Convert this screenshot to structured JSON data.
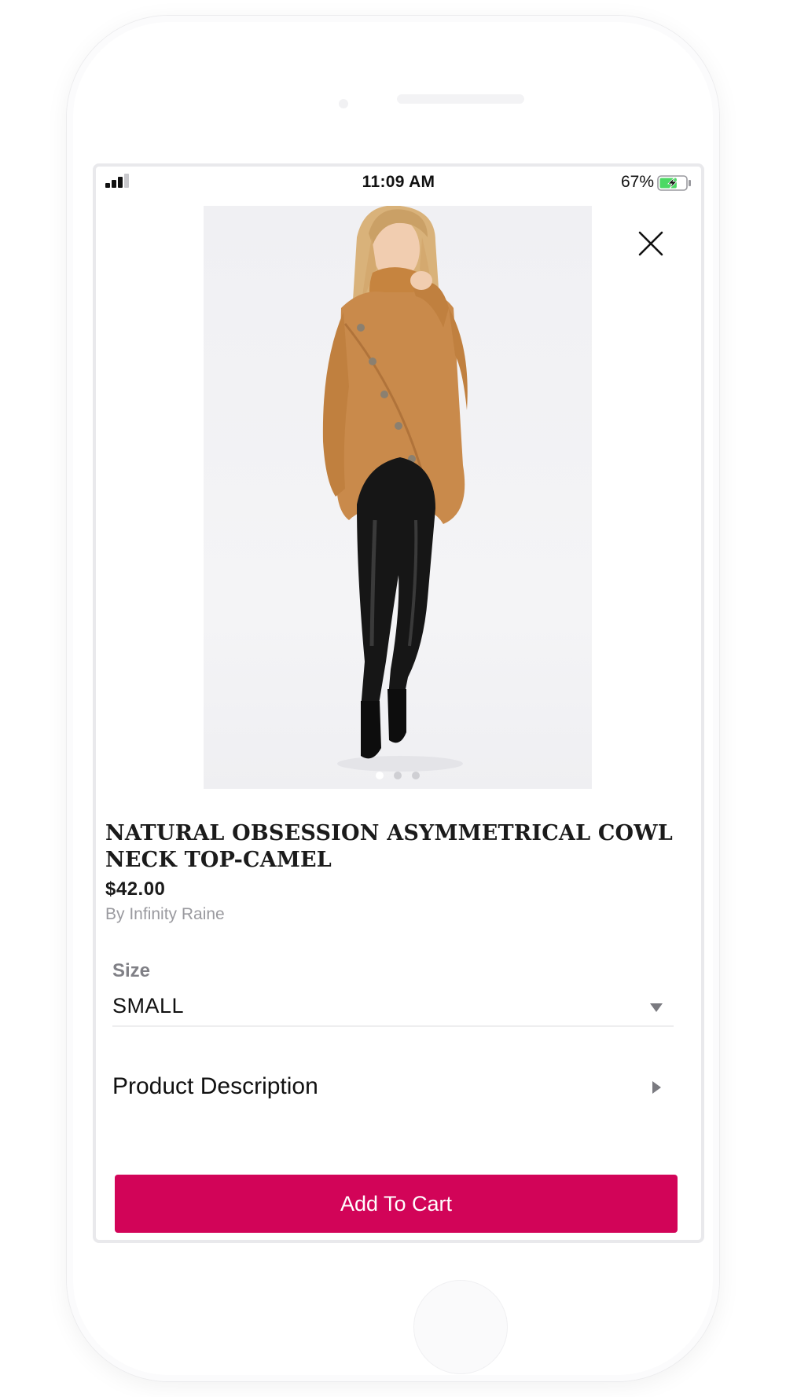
{
  "status_bar": {
    "time": "11:09 AM",
    "battery_percent": "67%",
    "battery_level": 0.67,
    "signal_bars": 3,
    "charging": true
  },
  "product": {
    "title": "NATURAL OBSESSION ASYMMETRICAL COWL NECK TOP-CAMEL",
    "price": "$42.00",
    "brand": "By Infinity Raine",
    "image_count": 3,
    "active_image_index": 0
  },
  "size": {
    "label": "Size",
    "selected": "SMALL"
  },
  "description": {
    "label": "Product Description"
  },
  "actions": {
    "add_to_cart_label": "Add To Cart"
  },
  "icons": {
    "close": "close-icon",
    "dropdown": "chevron-down-icon",
    "expand": "chevron-right-icon",
    "signal": "signal-icon",
    "battery": "battery-charging-icon"
  },
  "colors": {
    "accent": "#d20458",
    "text": "#111111",
    "muted": "#9a9a9f",
    "battery_fill": "#4cd964",
    "sweater": "#c98a4b",
    "leggings": "#161616"
  }
}
